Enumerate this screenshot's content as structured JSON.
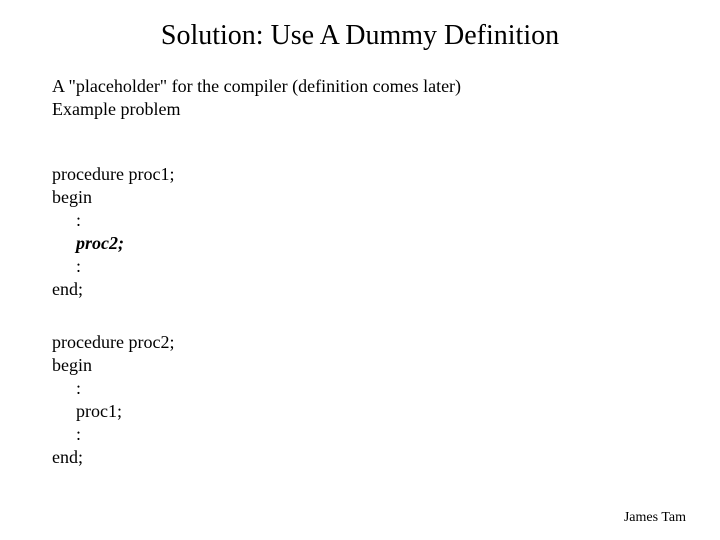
{
  "title": "Solution: Use A Dummy Definition",
  "intro": {
    "line1": "A \"placeholder\" for the compiler (definition comes later)",
    "line2": "Example problem"
  },
  "proc1": {
    "l1": "procedure proc1;",
    "l2": "begin",
    "l3": ":",
    "l4": "proc2;",
    "l5": ":",
    "l6": "end;"
  },
  "proc2": {
    "l1": "procedure proc2;",
    "l2": "begin",
    "l3": ":",
    "l4": "proc1;",
    "l5": ":",
    "l6": "end;"
  },
  "footer": "James Tam"
}
